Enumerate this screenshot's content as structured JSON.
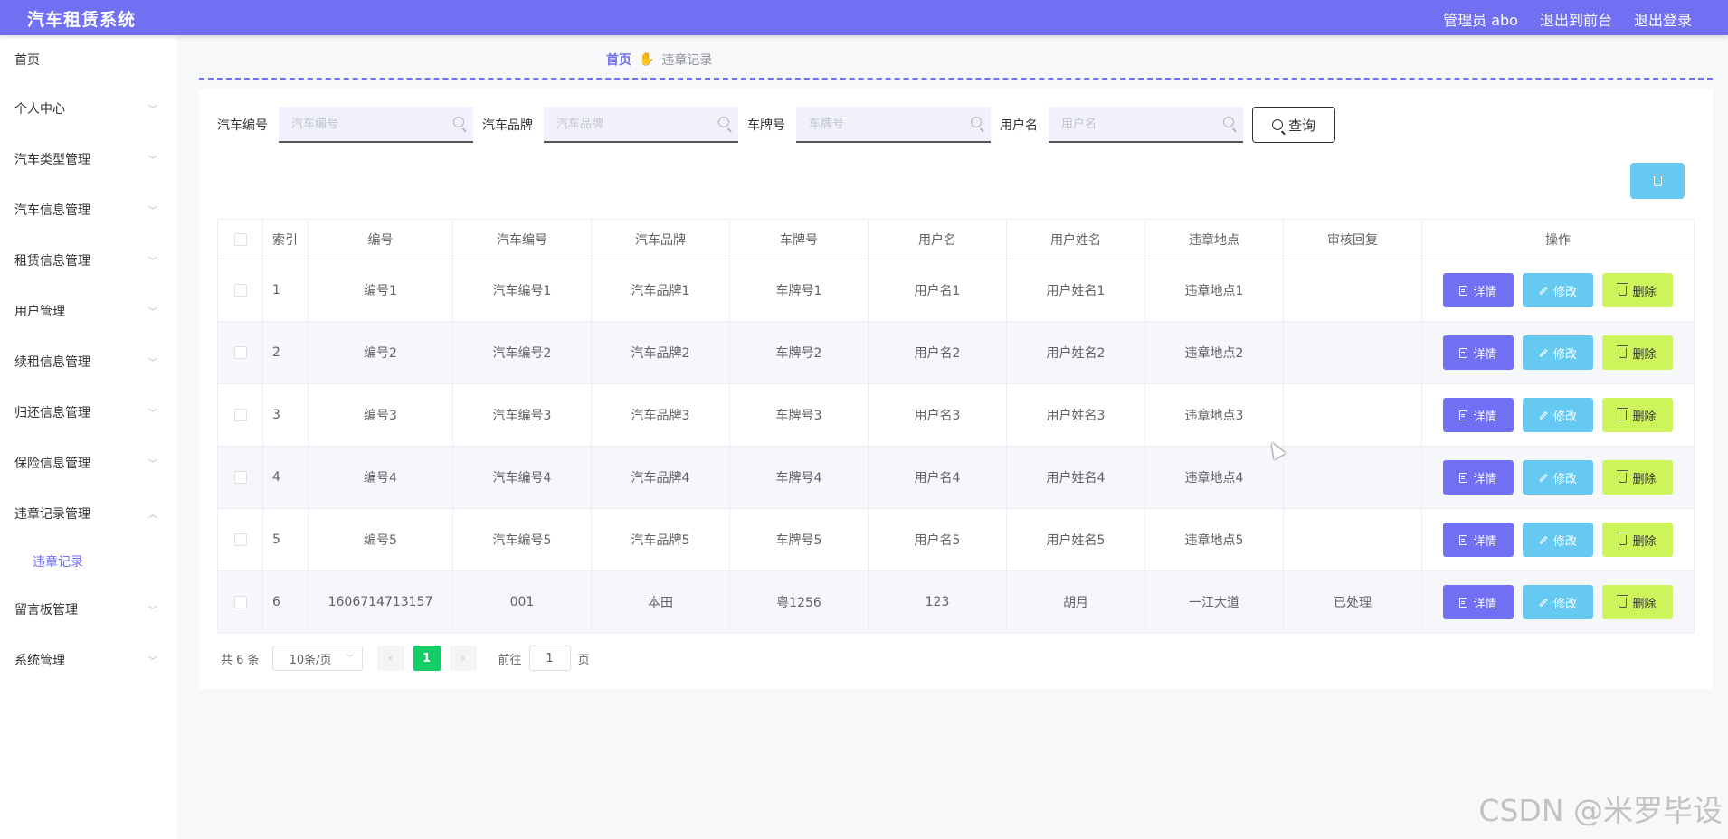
{
  "header": {
    "title": "汽车租赁系统",
    "admin": "管理员 abo",
    "front": "退出到前台",
    "logout": "退出登录"
  },
  "sidebar": {
    "items": [
      {
        "label": "首页"
      },
      {
        "label": "个人中心"
      },
      {
        "label": "汽车类型管理"
      },
      {
        "label": "汽车信息管理"
      },
      {
        "label": "租赁信息管理"
      },
      {
        "label": "用户管理"
      },
      {
        "label": "续租信息管理"
      },
      {
        "label": "归还信息管理"
      },
      {
        "label": "保险信息管理"
      },
      {
        "label": "违章记录管理"
      },
      {
        "label": "留言板管理"
      },
      {
        "label": "系统管理"
      }
    ],
    "subitem": "违章记录"
  },
  "breadcrumb": {
    "home": "首页",
    "current": "违章记录"
  },
  "search": {
    "f1_label": "汽车编号",
    "f1_placeholder": "汽车编号",
    "f2_label": "汽车品牌",
    "f2_placeholder": "汽车品牌",
    "f3_label": "车牌号",
    "f3_placeholder": "车牌号",
    "f4_label": "用户名",
    "f4_placeholder": "用户名",
    "button": "查询"
  },
  "table": {
    "columns": [
      "索引",
      "编号",
      "汽车编号",
      "汽车品牌",
      "车牌号",
      "用户名",
      "用户姓名",
      "违章地点",
      "审核回复",
      "操作"
    ],
    "rows": [
      {
        "idx": "1",
        "no": "编号1",
        "car_no": "汽车编号1",
        "brand": "汽车品牌1",
        "plate": "车牌号1",
        "user": "用户名1",
        "name": "用户姓名1",
        "place": "违章地点1",
        "reply": ""
      },
      {
        "idx": "2",
        "no": "编号2",
        "car_no": "汽车编号2",
        "brand": "汽车品牌2",
        "plate": "车牌号2",
        "user": "用户名2",
        "name": "用户姓名2",
        "place": "违章地点2",
        "reply": ""
      },
      {
        "idx": "3",
        "no": "编号3",
        "car_no": "汽车编号3",
        "brand": "汽车品牌3",
        "plate": "车牌号3",
        "user": "用户名3",
        "name": "用户姓名3",
        "place": "违章地点3",
        "reply": ""
      },
      {
        "idx": "4",
        "no": "编号4",
        "car_no": "汽车编号4",
        "brand": "汽车品牌4",
        "plate": "车牌号4",
        "user": "用户名4",
        "name": "用户姓名4",
        "place": "违章地点4",
        "reply": ""
      },
      {
        "idx": "5",
        "no": "编号5",
        "car_no": "汽车编号5",
        "brand": "汽车品牌5",
        "plate": "车牌号5",
        "user": "用户名5",
        "name": "用户姓名5",
        "place": "违章地点5",
        "reply": ""
      },
      {
        "idx": "6",
        "no": "1606714713157",
        "car_no": "001",
        "brand": "本田",
        "plate": "粤1256",
        "user": "123",
        "name": "胡月",
        "place": "一江大道",
        "reply": "已处理"
      }
    ],
    "actions": {
      "detail": "详情",
      "edit": "修改",
      "delete": "删除"
    }
  },
  "pagination": {
    "total": "共 6 条",
    "page_size": "10条/页",
    "current": "1",
    "goto_prefix": "前往",
    "goto_value": "1",
    "goto_suffix": "页"
  },
  "watermark": "CSDN @米罗毕设",
  "colors": {
    "primary": "#7170f2",
    "edit": "#66c9f2",
    "delete": "#cdf45a",
    "page_active": "#13ce66"
  }
}
